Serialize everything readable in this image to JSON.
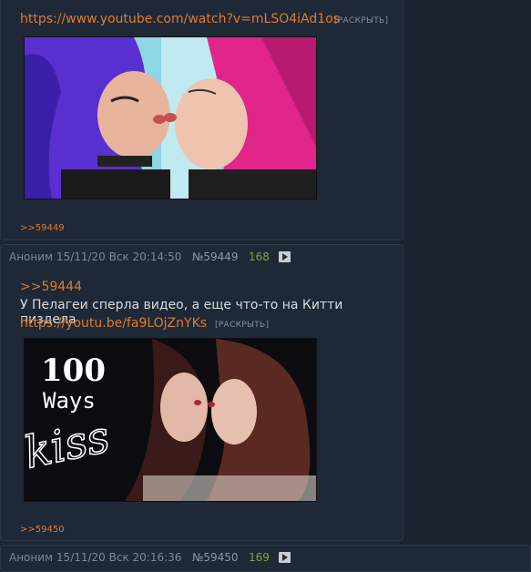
{
  "post1": {
    "url": "https://www.youtube.com/watch?v=mLSO4iAd1os",
    "expand_label": "[РАСКРЫТЬ]",
    "reply_link": ">>59449"
  },
  "post2": {
    "author": "Аноним",
    "date": "15/11/20 Вск 20:14:50",
    "number": "№59449",
    "count": "168",
    "quote": ">>59444",
    "text": "У Пелагеи сперла видео, а еще что-то на Китти пиздела",
    "url": "https://youtu.be/fa9LOjZnYKs",
    "expand_label": "[РАСКРЫТЬ]",
    "thumb_title_1": "100",
    "thumb_title_2": "Ways",
    "thumb_script": "kiss",
    "reply_link": ">>59450"
  },
  "post3": {
    "author": "Аноним",
    "date": "15/11/20 Вск 20:16:36",
    "number": "№59450",
    "count": "169"
  }
}
